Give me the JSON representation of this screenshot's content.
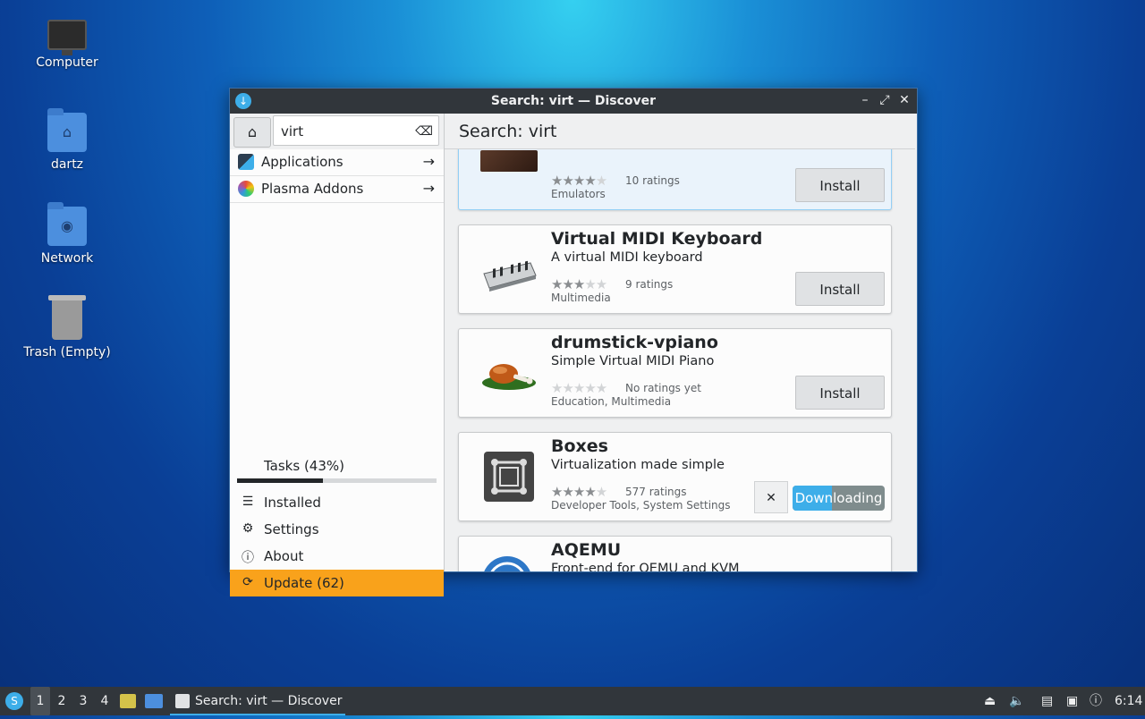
{
  "desktop": {
    "icons": [
      {
        "label": "Computer"
      },
      {
        "label": "dartz"
      },
      {
        "label": "Network"
      },
      {
        "label": "Trash (Empty)"
      }
    ]
  },
  "window": {
    "title": "Search: virt — Discover",
    "controls": {
      "minimize": "–",
      "maximize": "⤢",
      "close": "✕"
    }
  },
  "sidebar": {
    "search_value": "virt",
    "home_icon": "⌂",
    "categories": [
      {
        "label": "Applications"
      },
      {
        "label": "Plasma Addons"
      }
    ],
    "tasks_label": "Tasks (43%)",
    "tasks_progress": 0.43,
    "nav": [
      {
        "label": "Installed"
      },
      {
        "label": "Settings"
      },
      {
        "label": "About"
      },
      {
        "label": "Update (62)"
      }
    ]
  },
  "main": {
    "header": "Search: virt",
    "results": [
      {
        "name": "",
        "summary": "",
        "stars": 4,
        "ratings": "10 ratings",
        "category": "Emulators",
        "action": "Install"
      },
      {
        "name": "Virtual MIDI Keyboard",
        "summary": "A virtual MIDI keyboard",
        "stars": 3,
        "ratings": "9 ratings",
        "category": "Multimedia",
        "action": "Install"
      },
      {
        "name": "drumstick-vpiano",
        "summary": "Simple Virtual MIDI Piano",
        "stars": 0,
        "ratings": "No ratings yet",
        "category": "Education, Multimedia",
        "action": "Install"
      },
      {
        "name": "Boxes",
        "summary": "Virtualization made simple",
        "stars": 4,
        "ratings": "577 ratings",
        "category": "Developer Tools, System Settings",
        "action": "Downloading",
        "progress": 0.43,
        "cancel": "✕"
      },
      {
        "name": "AQEMU",
        "summary": "Front-end for QEMU and KVM",
        "stars": 0,
        "ratings": "",
        "category": "",
        "action": ""
      }
    ]
  },
  "taskbar": {
    "workspaces": [
      "1",
      "2",
      "3",
      "4"
    ],
    "task_title": "Search: virt — Discover",
    "clock": "6:14"
  },
  "colors": {
    "accent": "#3daee9",
    "update": "#f9a21b",
    "titlebar": "#31363b"
  }
}
